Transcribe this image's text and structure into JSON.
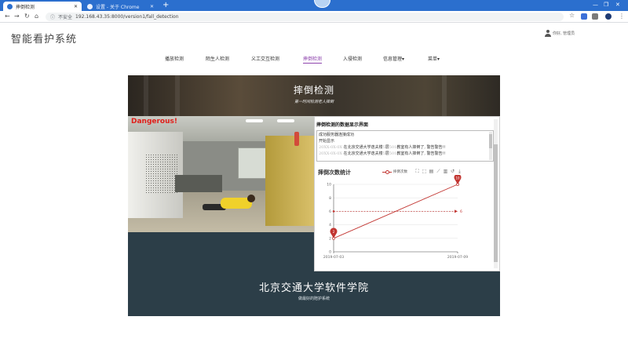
{
  "browser": {
    "tabs": [
      {
        "title": "摔倒检测",
        "active": true
      },
      {
        "title": "设置 - 关于 Chrome",
        "active": false
      }
    ],
    "address": {
      "secure_label": "不安全",
      "url": "192.168.43.35:8000/version1/fall_detection"
    },
    "colors": {
      "chrome_blue": "#2b6fce"
    }
  },
  "header": {
    "logo": "智能看护系统",
    "user": "你好, 管理员"
  },
  "nav": {
    "items": [
      {
        "label": "播放检测"
      },
      {
        "label": "陌生人检测"
      },
      {
        "label": "义工交互检测"
      },
      {
        "label": "摔倒检测",
        "active": true
      },
      {
        "label": "入侵检测"
      },
      {
        "label": "信息管理"
      },
      {
        "label": "菜单"
      }
    ]
  },
  "hero": {
    "title": "摔倒检测",
    "subtitle": "第一时间检测老人摔倒"
  },
  "camera": {
    "alert": "Dangerous!"
  },
  "panel": {
    "title": "摔倒检测的数据显示界面",
    "log": [
      {
        "text": "成功服务器连接成功",
        "dim": false
      },
      {
        "text": "开始显示",
        "dim": false
      },
      {
        "prefix": "20XX-0X-0X",
        "text": " 在北京交通大学逸夫楼",
        "mid": "5",
        "text2": "层",
        "mid2": "501",
        "text3": "教室有人摔倒了, 警告警告!!"
      },
      {
        "prefix": "20XX-0X-0X",
        "text": " 在北京交通大学逸夫楼",
        "mid": "5",
        "text2": "层",
        "mid2": "501",
        "text3": "教室有人摔倒了, 警告警告!!"
      }
    ],
    "chart_title": "摔倒次数统计",
    "legend": "摔倒次数"
  },
  "chart_data": {
    "type": "line",
    "title": "摔倒次数统计",
    "x": [
      "2019-07-03",
      "2019-07-09"
    ],
    "series": [
      {
        "name": "摔倒次数",
        "values": [
          2,
          10
        ]
      }
    ],
    "markpoints": [
      {
        "label": "2",
        "value": 2
      },
      {
        "label": "10",
        "value": 10
      }
    ],
    "markline": {
      "label": "6",
      "value": 6
    },
    "ylim": [
      0,
      10
    ],
    "yticks": [
      0,
      2,
      4,
      6,
      8,
      10
    ],
    "colors": {
      "series": "#c23531"
    }
  },
  "footer": {
    "title": "北京交通大学软件学院",
    "subtitle": "做最好的陪护系统"
  }
}
